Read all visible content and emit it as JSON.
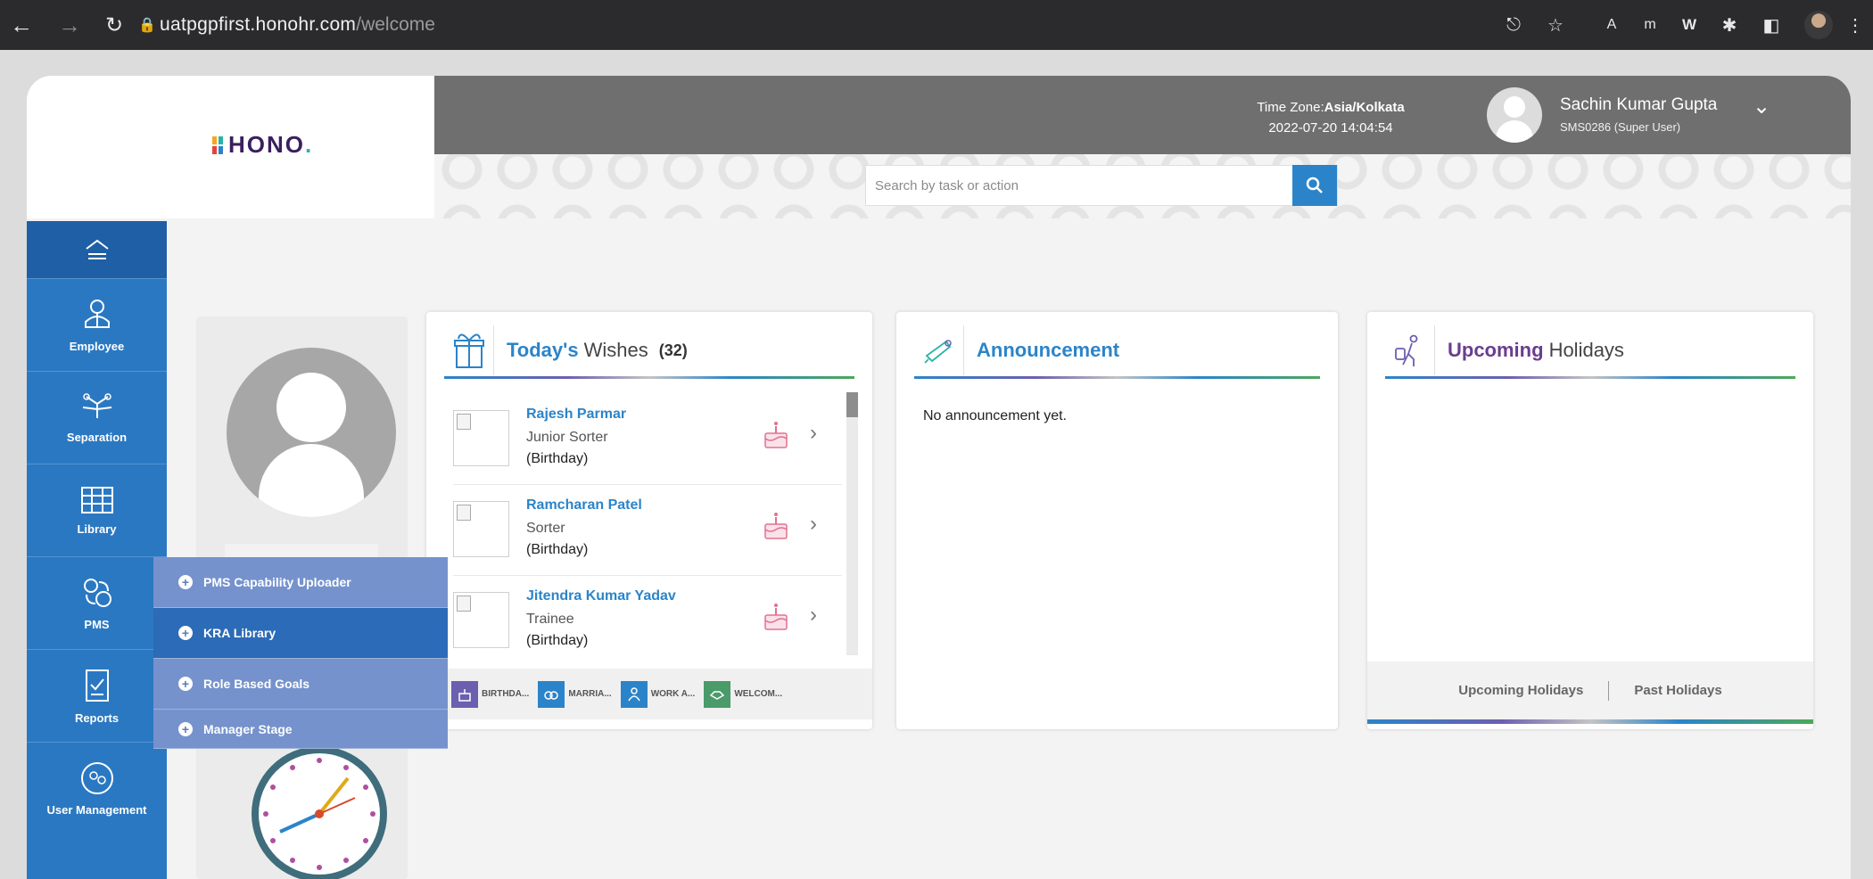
{
  "browser": {
    "url_host": "uatpgpfirst.honohr.com",
    "url_path": "/welcome"
  },
  "header": {
    "logo_text": "HONO",
    "timezone_prefix": "Time Zone:",
    "timezone_value": "Asia/Kolkata",
    "datetime": "2022-07-20 14:04:54",
    "user_name": "Sachin Kumar Gupta",
    "user_role": "SMS0286 (Super User)",
    "search_placeholder": "Search by task or action"
  },
  "sidebar": {
    "items": [
      {
        "label": "Employee",
        "icon": "employee-icon"
      },
      {
        "label": "Separation",
        "icon": "separation-icon"
      },
      {
        "label": "Library",
        "icon": "library-icon"
      },
      {
        "label": "PMS",
        "icon": "pms-icon"
      },
      {
        "label": "Reports",
        "icon": "reports-icon"
      },
      {
        "label": "User Management",
        "icon": "user-management-icon"
      }
    ]
  },
  "pms_menu": {
    "items": [
      "PMS Capability Uploader",
      "KRA Library",
      "Role Based Goals",
      "Manager Stage"
    ]
  },
  "wishes": {
    "title_bold": "Today's",
    "title_rest": "Wishes",
    "count": "(32)",
    "rows": [
      {
        "name": "Rajesh Parmar",
        "role": "Junior Sorter",
        "occasion": "(Birthday)"
      },
      {
        "name": "Ramcharan Patel",
        "role": "Sorter",
        "occasion": "(Birthday)"
      },
      {
        "name": "Jitendra Kumar Yadav",
        "role": "Trainee",
        "occasion": "(Birthday)"
      }
    ],
    "tabs": [
      "BIRTHDA...",
      "MARRIA...",
      "WORK A...",
      "WELCOM..."
    ]
  },
  "announcement": {
    "title": "Announcement",
    "empty_text": "No announcement yet."
  },
  "holidays": {
    "title_bold": "Upcoming",
    "title_rest": "Holidays",
    "tab_upcoming": "Upcoming Holidays",
    "tab_past": "Past Holidays"
  },
  "colors": {
    "primary": "#2b84c9",
    "sidebar": "#2b78c2",
    "header": "#6f6f6f",
    "brand_purple": "#3b1f5e"
  }
}
